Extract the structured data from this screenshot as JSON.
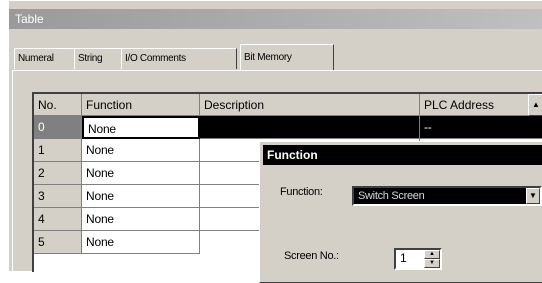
{
  "window": {
    "title": "Table"
  },
  "tabs": [
    {
      "label": "Numeral"
    },
    {
      "label": "String"
    },
    {
      "label": "I/O Comments"
    },
    {
      "label": "Bit Memory"
    }
  ],
  "grid": {
    "columns": [
      "No.",
      "Function",
      "Description",
      "PLC Address"
    ],
    "rows": [
      {
        "no": "0",
        "function": "None",
        "description": "",
        "plc": "--"
      },
      {
        "no": "1",
        "function": "None",
        "description": "",
        "plc": ""
      },
      {
        "no": "2",
        "function": "None",
        "description": "",
        "plc": ""
      },
      {
        "no": "3",
        "function": "None",
        "description": "",
        "plc": ""
      },
      {
        "no": "4",
        "function": "None",
        "description": "",
        "plc": ""
      },
      {
        "no": "5",
        "function": "None",
        "description": "",
        "plc": ""
      }
    ],
    "selected_row": 0
  },
  "dialog": {
    "title": "Function",
    "function_label": "Function:",
    "function_value": "Switch Screen",
    "screen_no_label": "Screen No.:",
    "screen_no_value": "1"
  },
  "icons": {
    "scroll_up": "arrow-up-icon",
    "dropdown": "chevron-down-icon",
    "spin_up": "spin-up-icon",
    "spin_down": "spin-down-icon"
  }
}
